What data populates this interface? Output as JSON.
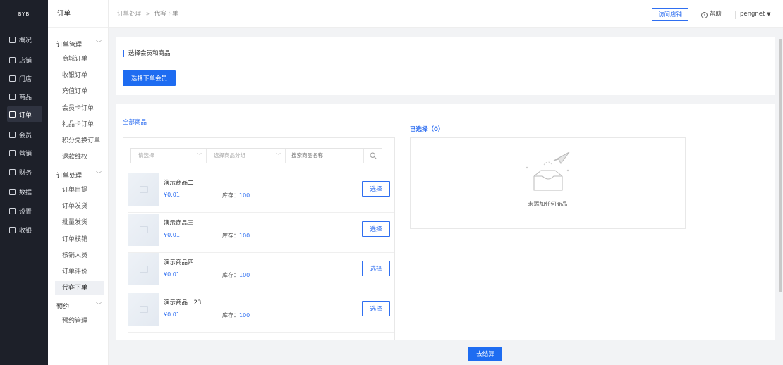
{
  "brand": "BYB",
  "nav": [
    {
      "label": "概况",
      "icon": "dashboard-icon",
      "active": false
    },
    {
      "label": "店铺",
      "icon": "shop-icon",
      "active": false
    },
    {
      "label": "门店",
      "icon": "store-icon",
      "active": false
    },
    {
      "label": "商品",
      "icon": "goods-icon",
      "active": false
    },
    {
      "label": "订单",
      "icon": "order-icon",
      "active": true
    },
    {
      "label": "会员",
      "icon": "member-icon",
      "active": false
    },
    {
      "label": "营销",
      "icon": "marketing-icon",
      "active": false
    },
    {
      "label": "财务",
      "icon": "finance-icon",
      "active": false
    },
    {
      "label": "数据",
      "icon": "data-icon",
      "active": false
    },
    {
      "label": "设置",
      "icon": "settings-icon",
      "active": false
    },
    {
      "label": "收银",
      "icon": "cashier-icon",
      "active": false
    }
  ],
  "submenu": {
    "title": "订单",
    "groups": [
      {
        "label": "订单管理",
        "items": [
          "商城订单",
          "收银订单",
          "充值订单",
          "会员卡订单",
          "礼品卡订单",
          "积分兑换订单",
          "退款维权"
        ]
      },
      {
        "label": "订单处理",
        "items": [
          "订单自提",
          "订单发货",
          "批量发货",
          "订单核销",
          "核销人员",
          "订单评价",
          "代客下单"
        ]
      },
      {
        "label": "预约",
        "items": [
          "预约管理"
        ]
      }
    ],
    "active_item": "代客下单"
  },
  "breadcrumb": {
    "parent": "订单处理",
    "separator": "»",
    "current": "代客下单"
  },
  "header": {
    "visit_store": "访问店铺",
    "help": "帮助",
    "user": "pengnet"
  },
  "member_section": {
    "title": "选择会员和商品",
    "button": "选择下单会员"
  },
  "goods": {
    "all_title": "全部商品",
    "filter_select_placeholder": "请选择",
    "category_placeholder": "选择商品分组",
    "search_placeholder": "搜索商品名称",
    "price_prefix": "¥",
    "stock_label": "库存：",
    "pick_label": "选择",
    "items": [
      {
        "name": "演示商品二",
        "price": "0.01",
        "stock": "100"
      },
      {
        "name": "演示商品三",
        "price": "0.01",
        "stock": "100"
      },
      {
        "name": "演示商品四",
        "price": "0.01",
        "stock": "100"
      },
      {
        "name": "演示商品一23",
        "price": "0.01",
        "stock": "100"
      }
    ]
  },
  "selected": {
    "title": "已选择（0）",
    "empty_text": "未添加任何商品"
  },
  "checkout_label": "去结算",
  "colors": {
    "primary": "#1e6cf1",
    "sidebar": "#1d2029"
  }
}
